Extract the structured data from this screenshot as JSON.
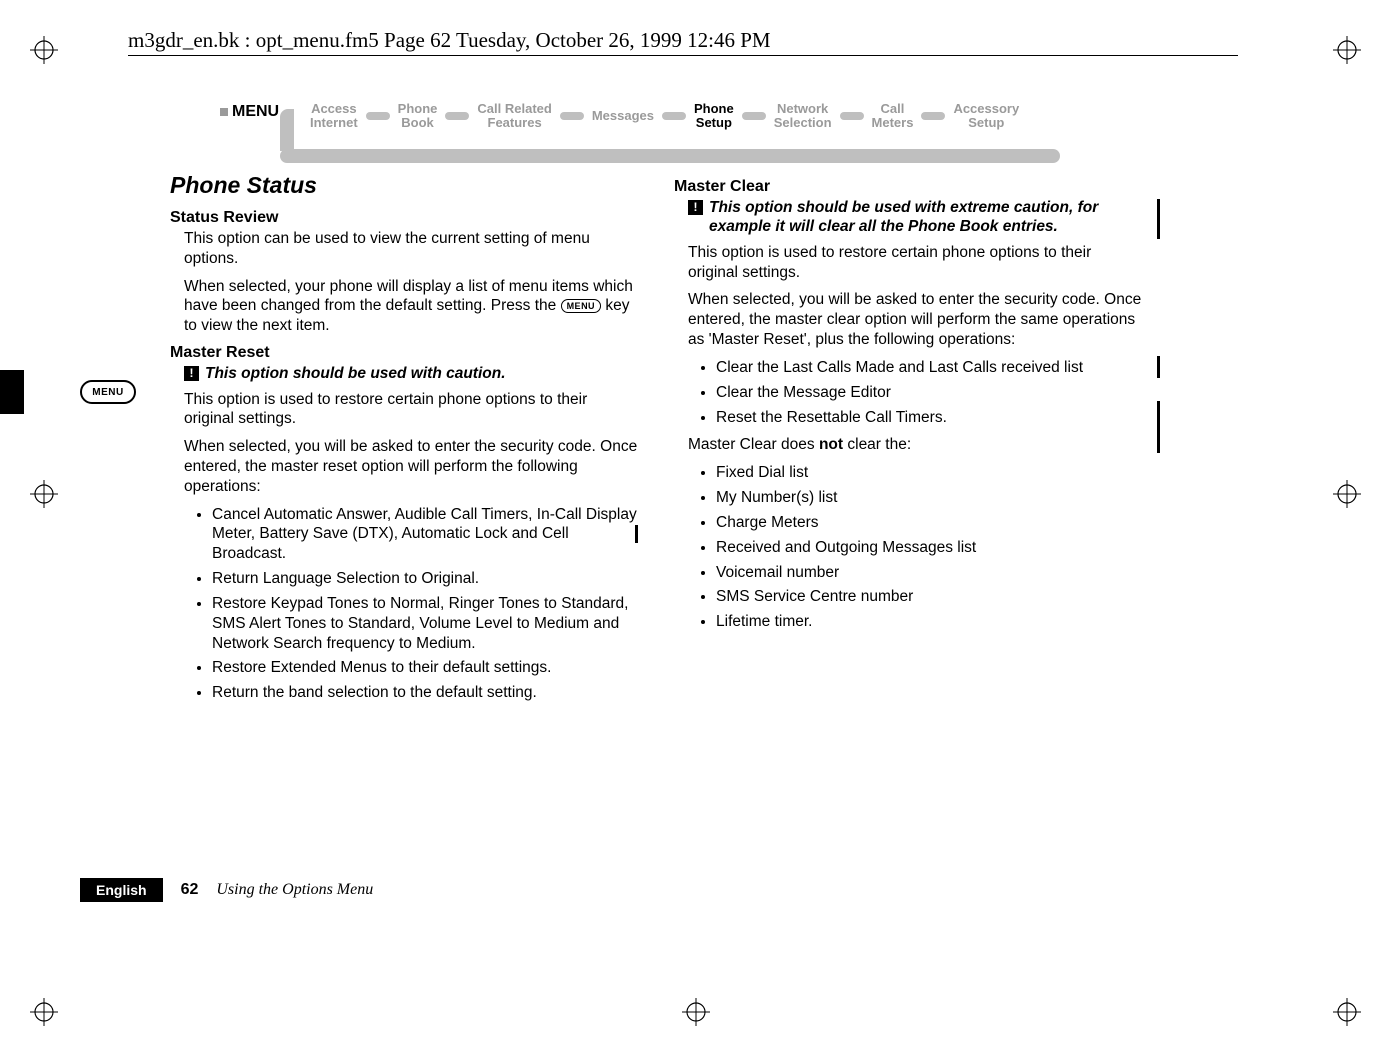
{
  "header": {
    "running_head": "m3gdr_en.bk : opt_menu.fm5  Page 62  Tuesday, October 26, 1999  12:46 PM"
  },
  "menu_banner": {
    "label": "MENU",
    "items": [
      {
        "line1": "Access",
        "line2": "Internet",
        "active": false
      },
      {
        "line1": "Phone",
        "line2": "Book",
        "active": false
      },
      {
        "line1": "Call Related",
        "line2": "Features",
        "active": false
      },
      {
        "line1": "Messages",
        "line2": "",
        "active": false
      },
      {
        "line1": "Phone",
        "line2": "Setup",
        "active": true
      },
      {
        "line1": "Network",
        "line2": "Selection",
        "active": false
      },
      {
        "line1": "Call",
        "line2": "Meters",
        "active": false
      },
      {
        "line1": "Accessory",
        "line2": "Setup",
        "active": false
      }
    ]
  },
  "left": {
    "section_title": "Phone Status",
    "status_review": {
      "heading": "Status Review",
      "p1": "This option can be used to view the current setting of menu options.",
      "p2_a": "When selected, your phone will display a list of menu items which have been changed from the default setting. Press the ",
      "p2_b": " key to view the next item.",
      "menu_key_text": "MENU"
    },
    "master_reset": {
      "heading": "Master Reset",
      "caution": "This option should be used with caution.",
      "p1": "This option is used to restore certain phone options to their original settings.",
      "p2": "When selected, you will be asked to enter the security code. Once entered, the master reset option will perform the following operations:",
      "bullets": [
        "Cancel Automatic Answer, Audible Call Timers, In-Call Display Meter, Battery Save (DTX), Automatic Lock and Cell Broadcast.",
        "Return Language Selection to Original.",
        "Restore Keypad Tones to Normal, Ringer Tones to Standard, SMS Alert Tones to Standard, Volume Level to Medium and Network Search frequency to Medium.",
        "Restore Extended Menus to their default settings.",
        "Return the band selection to the default setting."
      ]
    }
  },
  "right": {
    "master_clear": {
      "heading": "Master Clear",
      "caution": "This option should be used with extreme caution, for example it will clear all the Phone Book entries.",
      "p1": "This option is used to restore certain phone options to their original settings.",
      "p2": "When selected, you will be asked to enter the security code. Once entered, the master clear option will perform the same operations as 'Master Reset', plus the following operations:",
      "bullets1": [
        "Clear the Last Calls Made and Last Calls received list",
        "Clear the Message Editor",
        "Reset the Resettable Call Timers."
      ],
      "not_clear_intro_a": "Master Clear does ",
      "not_clear_intro_bold": "not",
      "not_clear_intro_b": " clear the:",
      "bullets2": [
        "Fixed Dial list",
        "My Number(s) list",
        "Charge Meters",
        "Received and Outgoing Messages list",
        "Voicemail number",
        "SMS Service Centre number",
        "Lifetime timer."
      ]
    }
  },
  "side": {
    "menu_badge": "MENU"
  },
  "footer": {
    "language": "English",
    "page_number": "62",
    "chapter_title": "Using the Options Menu"
  }
}
